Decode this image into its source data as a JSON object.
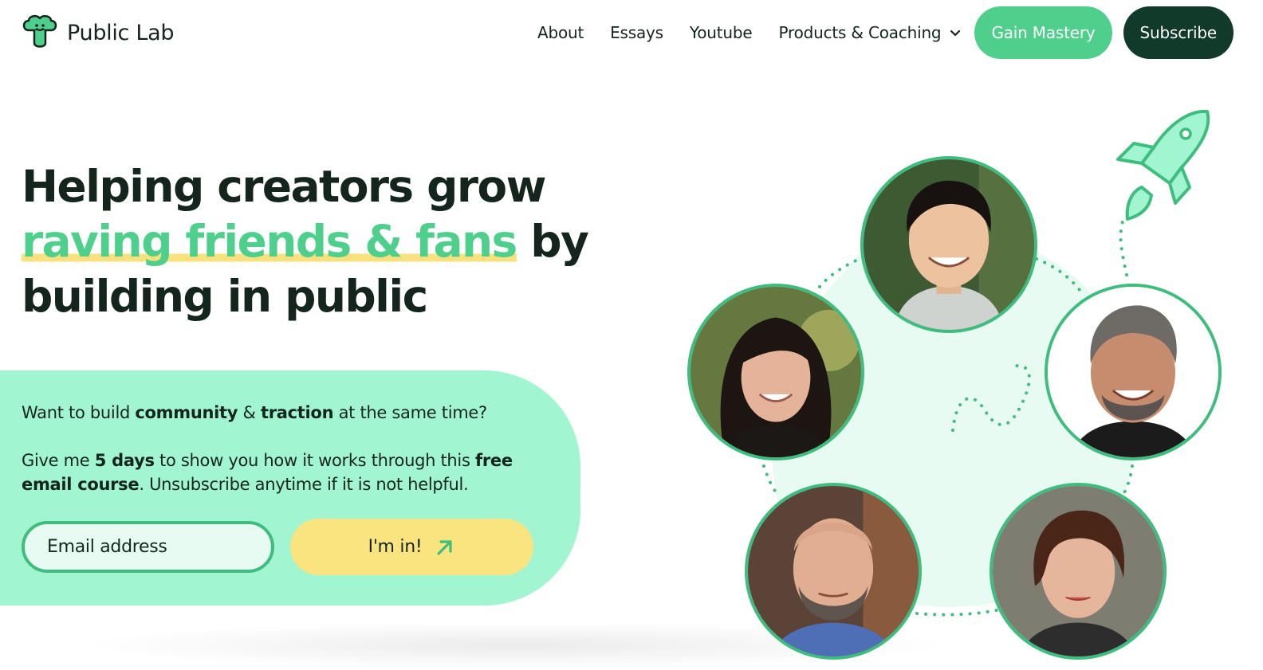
{
  "brand": {
    "name": "Public Lab",
    "logo_icon": "broccoli-icon"
  },
  "nav": {
    "links": [
      "About",
      "Essays",
      "Youtube"
    ],
    "dropdown_label": "Products & Coaching",
    "cta_primary": "Gain Mastery",
    "cta_secondary": "Subscribe"
  },
  "hero": {
    "headline_line1": "Helping creators grow",
    "headline_accent": "raving friends & fans",
    "headline_after_accent": " by",
    "headline_line3": "building in public"
  },
  "signup": {
    "q_pre": "Want to build ",
    "q_b1": "community",
    "q_mid": " & ",
    "q_b2": "traction",
    "q_post": " at the same time?",
    "d_pre": "Give me ",
    "d_b1": "5 days",
    "d_mid": " to show you how it works through this ",
    "d_b2": "free email course",
    "d_post": ". Unsubscribe anytime if it is not helpful.",
    "email_placeholder": "Email address",
    "submit_label": "I'm in!"
  },
  "colors": {
    "accent_green": "#4ecf8b",
    "dark_green": "#113a2a",
    "panel_mint": "#a1f5d1",
    "cta_yellow": "#fae47f",
    "highlight_yellow": "#f9e27e",
    "text_dark": "#14251d"
  },
  "illustration": {
    "icons": [
      "rocket-icon"
    ],
    "avatar_count": 5
  }
}
